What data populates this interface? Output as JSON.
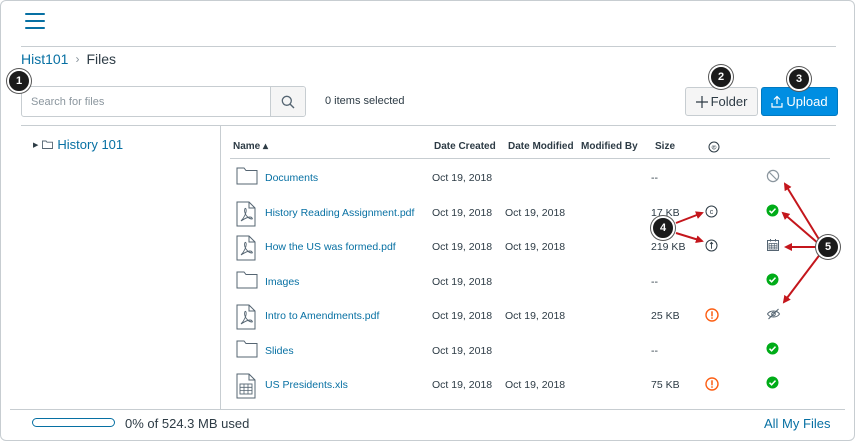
{
  "breadcrumb": {
    "course": "Hist101",
    "current": "Files"
  },
  "search": {
    "placeholder": "Search for files",
    "icon": "search-icon"
  },
  "toolbar": {
    "selected_text": "0 items selected",
    "folder_label": "Folder",
    "upload_label": "Upload"
  },
  "tree": {
    "root_label": "History 101"
  },
  "table": {
    "headers": {
      "name": "Name ▴",
      "created": "Date Created",
      "modified": "Date Modified",
      "modified_by": "Modified By",
      "size": "Size"
    },
    "rows": [
      {
        "type": "folder",
        "name": "Documents",
        "created": "Oct 19, 2018",
        "modified": "",
        "size": "--",
        "usage": "",
        "status": "unpublished"
      },
      {
        "type": "pdf",
        "name": "History Reading Assignment.pdf",
        "created": "Oct 19, 2018",
        "modified": "Oct 19, 2018",
        "size": "17 KB",
        "usage": "copyright",
        "status": "published"
      },
      {
        "type": "pdf",
        "name": "How the US was formed.pdf",
        "created": "Oct 19, 2018",
        "modified": "Oct 19, 2018",
        "size": "219 KB",
        "usage": "fair-use",
        "status": "scheduled"
      },
      {
        "type": "folder",
        "name": "Images",
        "created": "Oct 19, 2018",
        "modified": "",
        "size": "--",
        "usage": "",
        "status": "published"
      },
      {
        "type": "pdf",
        "name": "Intro to Amendments.pdf",
        "created": "Oct 19, 2018",
        "modified": "Oct 19, 2018",
        "size": "25 KB",
        "usage": "warning",
        "status": "hidden"
      },
      {
        "type": "folder",
        "name": "Slides",
        "created": "Oct 19, 2018",
        "modified": "",
        "size": "--",
        "usage": "",
        "status": "published"
      },
      {
        "type": "xls",
        "name": "US Presidents.xls",
        "created": "Oct 19, 2018",
        "modified": "Oct 19, 2018",
        "size": "75 KB",
        "usage": "warning",
        "status": "published"
      }
    ]
  },
  "footer": {
    "usage_text": "0% of 524.3 MB used",
    "used_fraction": 0,
    "all_files": "All My Files"
  },
  "callouts": [
    "1",
    "2",
    "3",
    "4",
    "5"
  ],
  "colors": {
    "link": "#0770a3",
    "primary": "#008ee2",
    "published": "#00ac18",
    "warning": "#fc5e13",
    "callout": "#1b1b1b",
    "arrow": "#c4161c"
  }
}
